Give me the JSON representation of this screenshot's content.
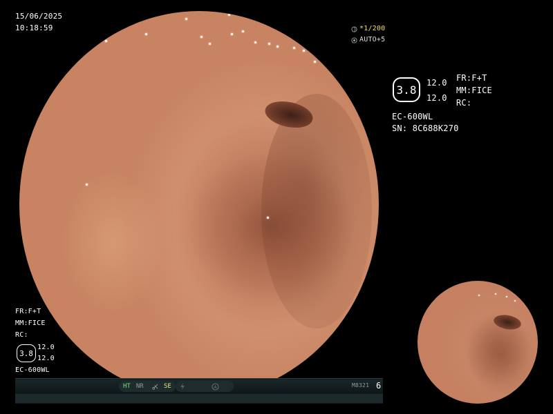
{
  "datetime": {
    "date": "15/06/2025",
    "time": "10:18:59"
  },
  "exposure": {
    "shutter": "*1/200",
    "auto": "AUTO+5"
  },
  "right_panel": {
    "enhancement_value": "3.8",
    "value_top": "12.0",
    "value_bottom": "12.0",
    "fr": "FR:F+T",
    "mm": "MM:FICE",
    "rc": "RC:",
    "scope_model": "EC-600WL",
    "serial": "SN: 8C688K270"
  },
  "left_panel": {
    "fr": "FR:F+T",
    "mm": "MM:FICE",
    "rc": "RC:",
    "enhancement_value": "3.8",
    "value_top": "12.0",
    "value_bottom": "12.0",
    "scope_model": "EC-600WL"
  },
  "status_bar": {
    "ht": "HT",
    "nr": "NR",
    "se": "SE",
    "code": "M8321",
    "count": "6"
  },
  "icons": {
    "shutter_icon": "aperture-icon",
    "auto_icon": "iris-icon",
    "se_icon": "scissors-icon",
    "flash_icon": "lightning-icon",
    "a_icon": "circled-a-icon"
  },
  "colors": {
    "tissue": "#c07a5b",
    "exposure_yellow": "#f2e05a",
    "ht_green": "#6ee67a"
  }
}
